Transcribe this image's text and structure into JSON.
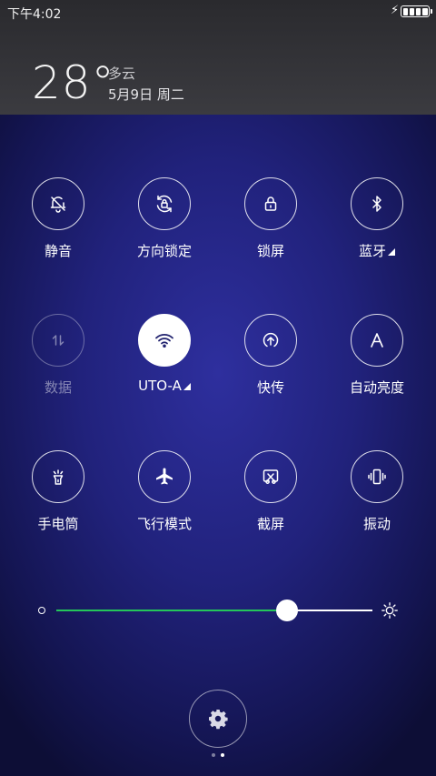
{
  "status_bar": {
    "time": "下午4:02",
    "charging_icon": "lightning-icon",
    "battery_icon": "battery-full-icon"
  },
  "weather": {
    "temperature": "28°",
    "condition": "多云",
    "date": "5月9日 周二"
  },
  "toggles": [
    {
      "label": "静音",
      "icon": "bell-muted-icon",
      "state": "on"
    },
    {
      "label": "方向锁定",
      "icon": "rotation-lock-icon",
      "state": "on"
    },
    {
      "label": "锁屏",
      "icon": "lock-icon",
      "state": "on"
    },
    {
      "label": "蓝牙",
      "icon": "bluetooth-icon",
      "state": "on",
      "has_more": true
    },
    {
      "label": "数据",
      "icon": "mobile-data-icon",
      "state": "disabled"
    },
    {
      "label": "UTO-A",
      "icon": "wifi-icon",
      "state": "active",
      "has_more": true
    },
    {
      "label": "快传",
      "icon": "quick-transfer-icon",
      "state": "on"
    },
    {
      "label": "自动亮度",
      "icon": "auto-brightness-icon",
      "state": "on"
    },
    {
      "label": "手电筒",
      "icon": "flashlight-icon",
      "state": "on"
    },
    {
      "label": "飞行模式",
      "icon": "airplane-icon",
      "state": "on"
    },
    {
      "label": "截屏",
      "icon": "screenshot-icon",
      "state": "on"
    },
    {
      "label": "振动",
      "icon": "vibrate-icon",
      "state": "on"
    }
  ],
  "brightness": {
    "level": 0.73,
    "low_icon": "brightness-low-icon",
    "high_icon": "brightness-high-icon",
    "fill_color": "#24c65a"
  },
  "settings_icon": "gear-icon",
  "page_indicator": {
    "pages": 2,
    "current": 2
  }
}
